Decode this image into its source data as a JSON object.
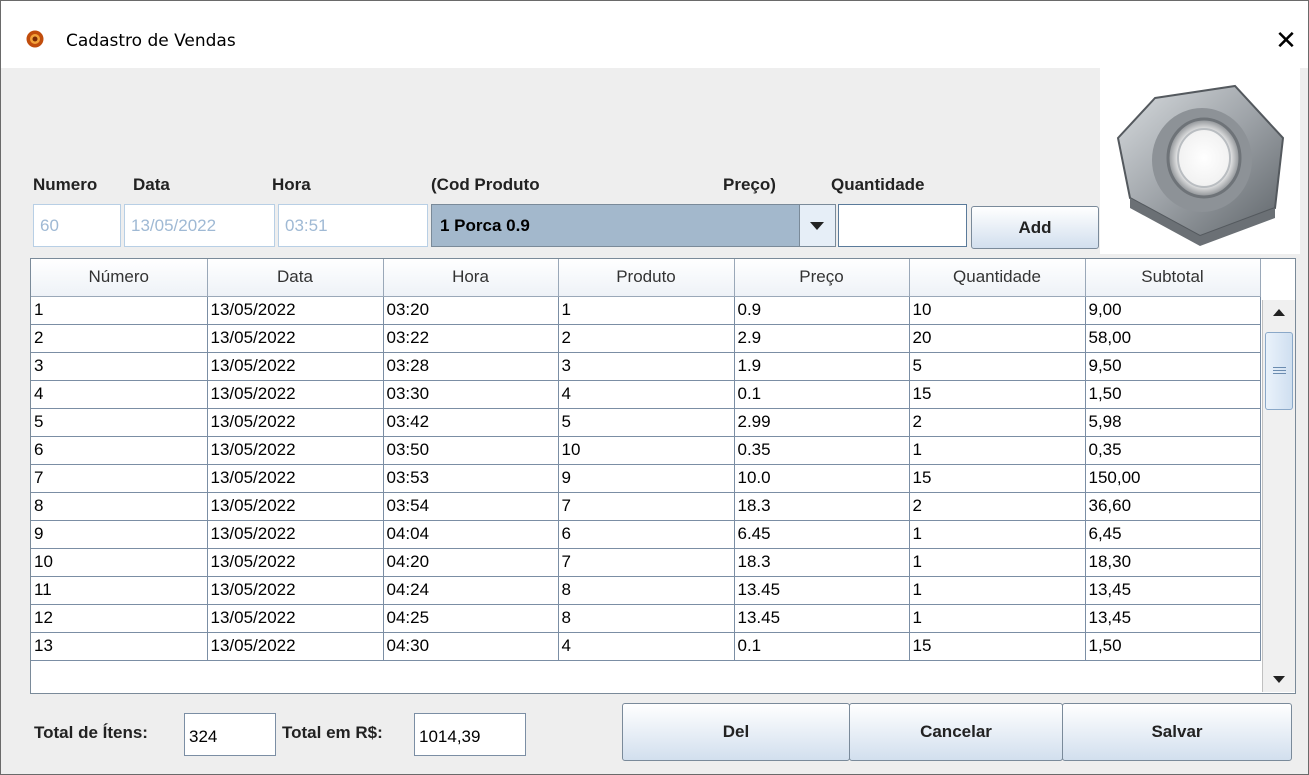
{
  "window": {
    "title": "Cadastro de Vendas",
    "close_label": "✕"
  },
  "form": {
    "labels": {
      "numero": "Numero",
      "data": "Data",
      "hora": "Hora",
      "cod_produto": "(Cod Produto",
      "preco": "Preço)",
      "quantidade": "Quantidade"
    },
    "numero_value": "60",
    "data_value": "13/05/2022",
    "hora_value": "03:51",
    "produto_selected": "1 Porca 0.9",
    "quantidade_value": "",
    "add_label": "Add"
  },
  "table": {
    "columns": [
      "Número",
      "Data",
      "Hora",
      "Produto",
      "Preço",
      "Quantidade",
      "Subtotal"
    ],
    "rows": [
      [
        "1",
        "13/05/2022",
        "03:20",
        "1",
        "0.9",
        "10",
        "9,00"
      ],
      [
        "2",
        "13/05/2022",
        "03:22",
        "2",
        "2.9",
        "20",
        "58,00"
      ],
      [
        "3",
        "13/05/2022",
        "03:28",
        "3",
        "1.9",
        "5",
        "9,50"
      ],
      [
        "4",
        "13/05/2022",
        "03:30",
        "4",
        "0.1",
        "15",
        "1,50"
      ],
      [
        "5",
        "13/05/2022",
        "03:42",
        "5",
        "2.99",
        "2",
        "5,98"
      ],
      [
        "6",
        "13/05/2022",
        "03:50",
        "10",
        "0.35",
        "1",
        "0,35"
      ],
      [
        "7",
        "13/05/2022",
        "03:53",
        "9",
        "10.0",
        "15",
        "150,00"
      ],
      [
        "8",
        "13/05/2022",
        "03:54",
        "7",
        "18.3",
        "2",
        "36,60"
      ],
      [
        "9",
        "13/05/2022",
        "04:04",
        "6",
        "6.45",
        "1",
        "6,45"
      ],
      [
        "10",
        "13/05/2022",
        "04:20",
        "7",
        "18.3",
        "1",
        "18,30"
      ],
      [
        "11",
        "13/05/2022",
        "04:24",
        "8",
        "13.45",
        "1",
        "13,45"
      ],
      [
        "12",
        "13/05/2022",
        "04:25",
        "8",
        "13.45",
        "1",
        "13,45"
      ],
      [
        "13",
        "13/05/2022",
        "04:30",
        "4",
        "0.1",
        "15",
        "1,50"
      ]
    ]
  },
  "footer": {
    "total_itens_label": "Total de Ítens:",
    "total_itens_value": "324",
    "total_rs_label": "Total em R$:",
    "total_rs_value": "1014,39",
    "del_label": "Del",
    "cancelar_label": "Cancelar",
    "salvar_label": "Salvar"
  },
  "icons": {
    "app": "java-coffee-icon",
    "product_image": "hex-nut-icon"
  },
  "colors": {
    "combo_selected_bg": "#a3b8cc",
    "disabled_text": "#9fb9d4",
    "grid_line": "#7b8ea4"
  }
}
